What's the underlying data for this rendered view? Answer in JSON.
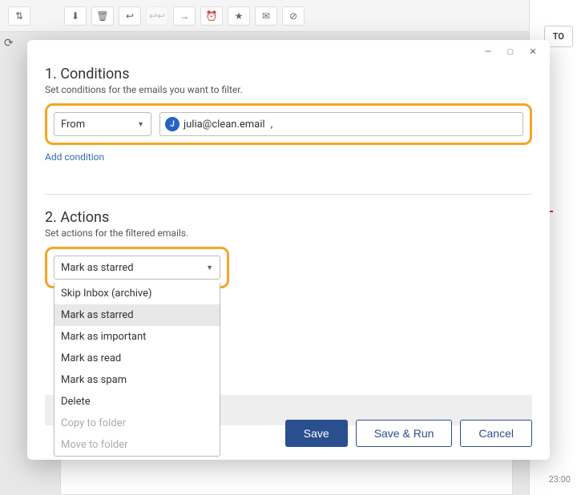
{
  "background": {
    "right_button": "TO",
    "time_label_1": "",
    "time_label_2": "23:00"
  },
  "modal": {
    "window_controls": {
      "minimize": "—",
      "maximize": "□",
      "close": "✕"
    },
    "conditions": {
      "heading": "1. Conditions",
      "sub": "Set conditions for the emails you want to filter.",
      "field_label": "From",
      "email_avatar": "J",
      "email_value": "julia@clean.email",
      "add_link": "Add condition"
    },
    "actions": {
      "heading": "2. Actions",
      "sub": "Set actions for the filtered emails.",
      "selected": "Mark as starred",
      "options": [
        {
          "label": "Skip Inbox (archive)",
          "state": "normal"
        },
        {
          "label": "Mark as starred",
          "state": "selected"
        },
        {
          "label": "Mark as important",
          "state": "normal"
        },
        {
          "label": "Mark as read",
          "state": "normal"
        },
        {
          "label": "Mark as spam",
          "state": "normal"
        },
        {
          "label": "Delete",
          "state": "normal"
        },
        {
          "label": "Copy to folder",
          "state": "disabled"
        },
        {
          "label": "Move to folder",
          "state": "disabled"
        }
      ]
    },
    "footer": {
      "save": "Save",
      "save_run": "Save & Run",
      "cancel": "Cancel"
    }
  }
}
